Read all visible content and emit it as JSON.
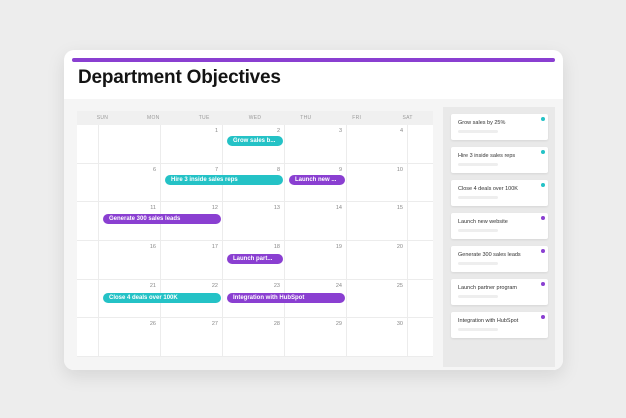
{
  "colors": {
    "accent": "#8a3fd1",
    "teal": "#24c2c6",
    "purple": "#8a3fd1"
  },
  "header": {
    "title": "Department Objectives"
  },
  "calendar": {
    "days_of_week": [
      "SUN",
      "MON",
      "TUE",
      "WED",
      "THU",
      "FRI",
      "SAT"
    ],
    "weeks": [
      [
        "",
        "",
        "1",
        "2",
        "3",
        "4",
        ""
      ],
      [
        "",
        "6",
        "7",
        "8",
        "9",
        "10",
        ""
      ],
      [
        "",
        "11",
        "12",
        "13",
        "14",
        "15",
        ""
      ],
      [
        "",
        "16",
        "17",
        "18",
        "19",
        "20",
        ""
      ],
      [
        "",
        "21",
        "22",
        "23",
        "24",
        "25",
        ""
      ],
      [
        "",
        "26",
        "27",
        "28",
        "29",
        "30",
        ""
      ]
    ],
    "events": [
      {
        "label": "Grow sales b...",
        "color": "teal"
      },
      {
        "label": "Hire 3 inside sales reps",
        "color": "teal"
      },
      {
        "label": "Launch new ...",
        "color": "purple"
      },
      {
        "label": "Generate 300 sales leads",
        "color": "purple"
      },
      {
        "label": "Launch part...",
        "color": "purple"
      },
      {
        "label": "Close 4 deals over 100K",
        "color": "teal"
      },
      {
        "label": "Integration with HubSpot",
        "color": "purple"
      }
    ]
  },
  "sidebar": {
    "items": [
      {
        "label": "Grow sales by 25%",
        "color": "teal"
      },
      {
        "label": "Hire 3 inside sales reps",
        "color": "teal"
      },
      {
        "label": "Close 4 deals over 100K",
        "color": "teal"
      },
      {
        "label": "Launch new website",
        "color": "purple"
      },
      {
        "label": "Generate 300 sales leads",
        "color": "purple"
      },
      {
        "label": "Launch partner program",
        "color": "purple"
      },
      {
        "label": "Integration with HubSpot",
        "color": "purple"
      }
    ]
  }
}
